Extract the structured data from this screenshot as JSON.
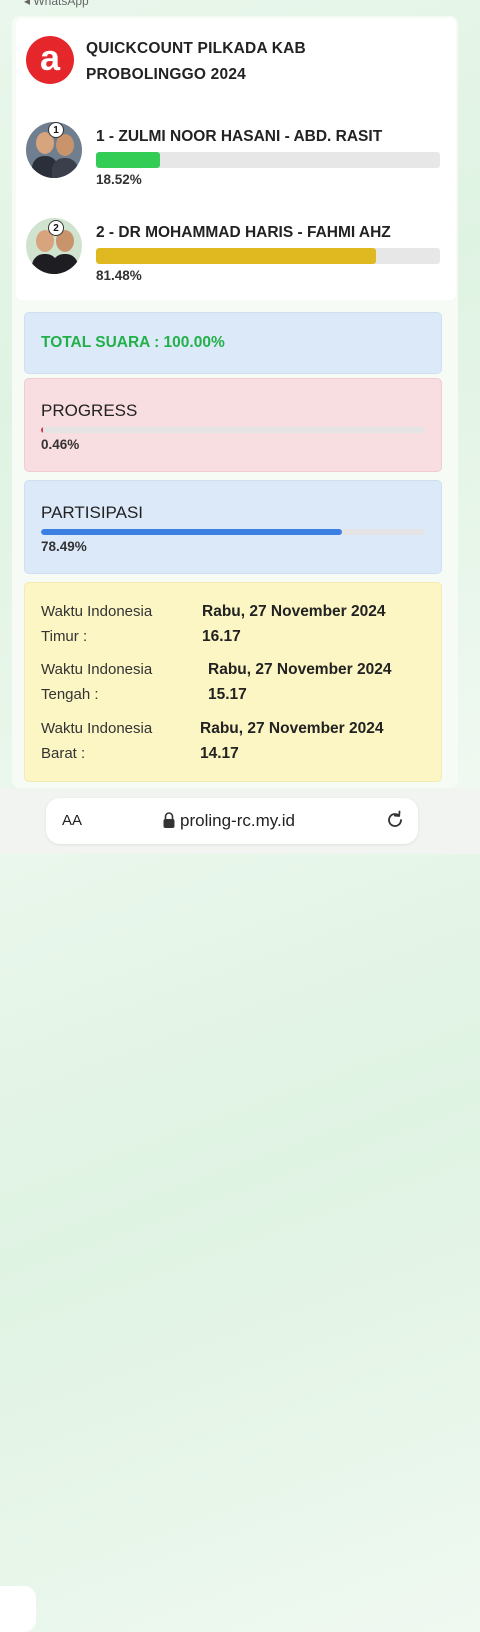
{
  "status_back": "◂ WhatsApp",
  "header": {
    "logo_letter": "a",
    "title": "QUICKCOUNT PILKADA KAB PROBOLINGGO 2024"
  },
  "candidates": [
    {
      "number": "1",
      "name": "1 - ZULMI NOOR HASANI - ABD. RASIT",
      "percent_label": "18.52%",
      "percent": 18.52,
      "color": "#33cc55"
    },
    {
      "number": "2",
      "name": "2 - DR MOHAMMAD HARIS - FAHMI AHZ",
      "percent_label": "81.48%",
      "percent": 81.48,
      "color": "#e0b820"
    }
  ],
  "total": {
    "label": "TOTAL SUARA : 100.00%"
  },
  "progress": {
    "heading": "PROGRESS",
    "percent_label": "0.46%",
    "percent": 0.46,
    "color": "#d9334a"
  },
  "partisipasi": {
    "heading": "PARTISIPASI",
    "percent_label": "78.49%",
    "percent": 78.49,
    "color": "#3b7fe3"
  },
  "times": [
    {
      "label": "Waktu Indonesia Timur :",
      "date": "Rabu, 27 November 2024",
      "time": "16.17"
    },
    {
      "label": "Waktu Indonesia Tengah :",
      "date": "Rabu, 27 November 2024",
      "time": "15.17"
    },
    {
      "label": "Waktu Indonesia Barat :",
      "date": "Rabu, 27 November 2024",
      "time": "14.17"
    }
  ],
  "browser": {
    "aa_label": "AA",
    "url": "proling-rc.my.id",
    "lock_icon": "lock-icon",
    "reload_icon": "reload-icon"
  }
}
